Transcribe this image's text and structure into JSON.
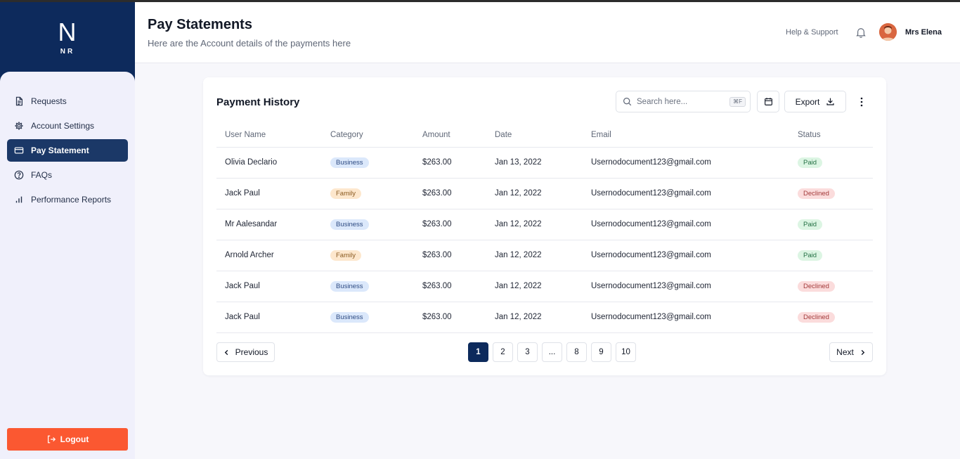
{
  "brand": {
    "letter": "N",
    "sub": "NR"
  },
  "sidebar": {
    "items": [
      {
        "label": "Requests",
        "icon": "document-icon",
        "active": false
      },
      {
        "label": "Account Settings",
        "icon": "gear-icon",
        "active": false
      },
      {
        "label": "Pay Statement",
        "icon": "card-icon",
        "active": true
      },
      {
        "label": "FAQs",
        "icon": "question-icon",
        "active": false
      },
      {
        "label": "Performance Reports",
        "icon": "bar-chart-icon",
        "active": false
      }
    ],
    "logout_label": "Logout"
  },
  "header": {
    "title": "Pay Statements",
    "subtitle": "Here are the Account details of the payments here",
    "help_label": "Help & Support",
    "user_name": "Mrs Elena"
  },
  "card": {
    "title": "Payment History",
    "search_placeholder": "Search here...",
    "search_shortcut": "⌘F",
    "export_label": "Export"
  },
  "table": {
    "columns": [
      "User Name",
      "Category",
      "Amount",
      "Date",
      "Email",
      "Status"
    ],
    "rows": [
      {
        "name": "Olivia Declario",
        "category": "Business",
        "amount": "$263.00",
        "date": "Jan 13, 2022",
        "email": "Usernodocument123@gmail.com",
        "status": "Paid"
      },
      {
        "name": "Jack Paul",
        "category": "Family",
        "amount": "$263.00",
        "date": "Jan 12, 2022",
        "email": "Usernodocument123@gmail.com",
        "status": "Declined"
      },
      {
        "name": "Mr Aalesandar",
        "category": "Business",
        "amount": "$263.00",
        "date": "Jan 12, 2022",
        "email": "Usernodocument123@gmail.com",
        "status": "Paid"
      },
      {
        "name": "Arnold Archer",
        "category": "Family",
        "amount": "$263.00",
        "date": "Jan 12, 2022",
        "email": "Usernodocument123@gmail.com",
        "status": "Paid"
      },
      {
        "name": "Jack Paul",
        "category": "Business",
        "amount": "$263.00",
        "date": "Jan 12, 2022",
        "email": "Usernodocument123@gmail.com",
        "status": "Declined"
      },
      {
        "name": "Jack Paul",
        "category": "Business",
        "amount": "$263.00",
        "date": "Jan 12, 2022",
        "email": "Usernodocument123@gmail.com",
        "status": "Declined"
      }
    ]
  },
  "pagination": {
    "previous_label": "Previous",
    "next_label": "Next",
    "pages": [
      "1",
      "2",
      "3",
      "...",
      "8",
      "9",
      "10"
    ],
    "current": "1"
  },
  "colors": {
    "primary": "#0d2a5c",
    "logout": "#fb5831",
    "sidebar_bg": "#f0f0fb"
  }
}
